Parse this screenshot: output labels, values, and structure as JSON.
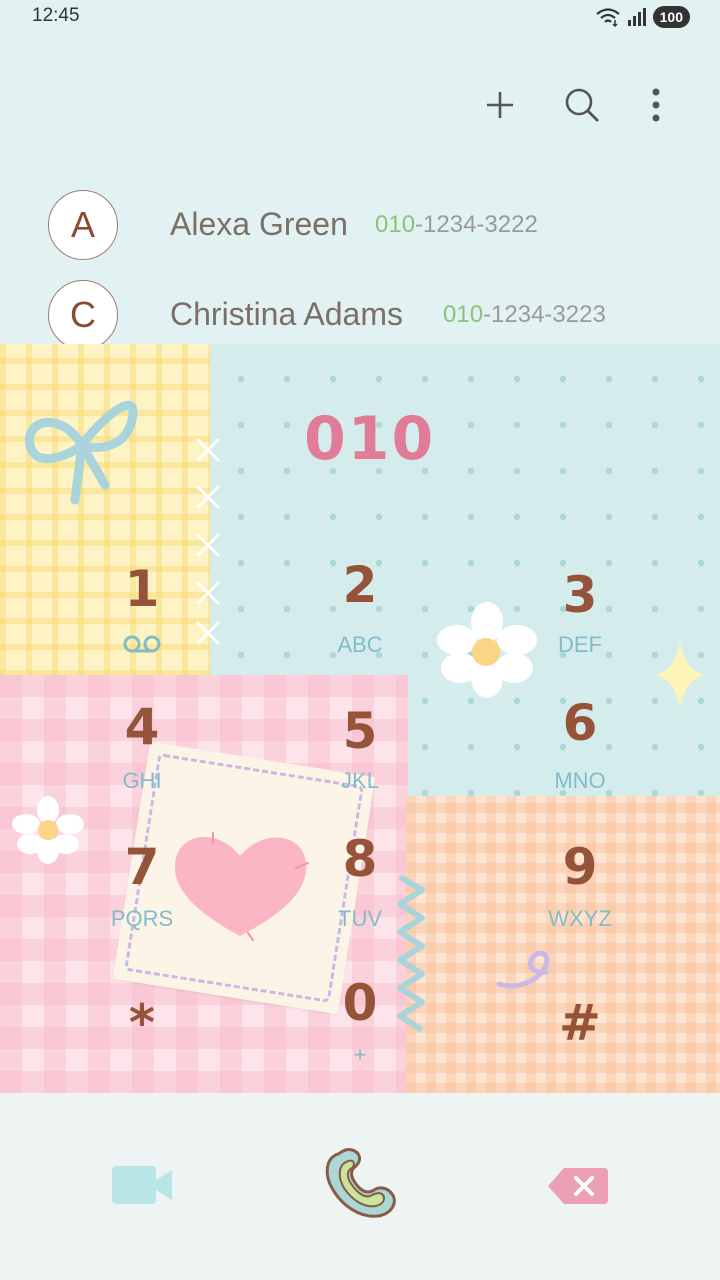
{
  "status_bar": {
    "time": "12:45",
    "battery": "100",
    "icons": [
      "wifi-icon",
      "signal-icon",
      "battery-icon"
    ]
  },
  "toolbar": {
    "actions": [
      "add-icon",
      "search-icon",
      "more-options-icon"
    ]
  },
  "contacts": [
    {
      "initial": "A",
      "name": "Alexa Green",
      "number_prefix": "010",
      "number_rest": "-1234-3222"
    },
    {
      "initial": "C",
      "name": "Christina Adams",
      "number_prefix": "010",
      "number_rest": "-1234-3223"
    }
  ],
  "dialer": {
    "entered_digits": "010",
    "keys": [
      {
        "digit": "1",
        "letters": ""
      },
      {
        "digit": "2",
        "letters": "ABC"
      },
      {
        "digit": "3",
        "letters": "DEF"
      },
      {
        "digit": "4",
        "letters": "GHI"
      },
      {
        "digit": "5",
        "letters": "JKL"
      },
      {
        "digit": "6",
        "letters": "MNO"
      },
      {
        "digit": "7",
        "letters": "PQRS"
      },
      {
        "digit": "8",
        "letters": "TUV"
      },
      {
        "digit": "9",
        "letters": "WXYZ"
      },
      {
        "digit": "*",
        "letters": ""
      },
      {
        "digit": "0",
        "letters": "+"
      },
      {
        "digit": "#",
        "letters": ""
      }
    ]
  },
  "bottom_bar": {
    "actions": [
      "video-call-icon",
      "call-icon",
      "backspace-icon"
    ]
  },
  "colors": {
    "background": "#e2f1f1",
    "accent_pink": "#e07c98",
    "digit_brown": "#955339",
    "letters_blue": "#83bcc9",
    "number_green": "#8dc27a"
  }
}
